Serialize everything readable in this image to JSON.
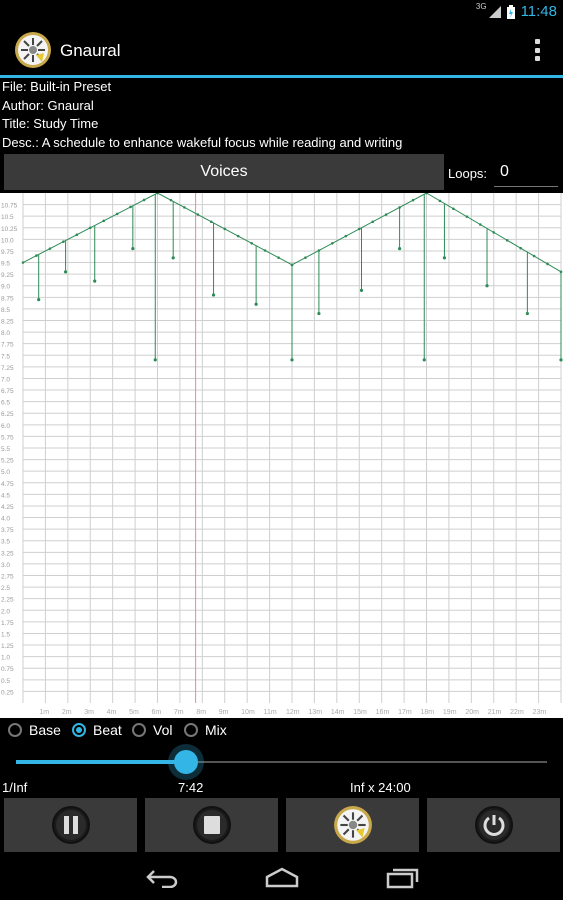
{
  "status": {
    "network": "3G",
    "time": "11:48"
  },
  "app": {
    "title": "Gnaural",
    "icon": "gnaural-logo-icon"
  },
  "info": {
    "file": "File: Built-in Preset",
    "author": "Author: Gnaural",
    "title": "Title: Study Time",
    "desc": "Desc.: A schedule to enhance wakeful focus while reading and writing"
  },
  "voices_label": "Voices",
  "loops": {
    "label": "Loops:",
    "value": "0"
  },
  "graph": {
    "y_labels": [
      "10.75",
      "10.5",
      "10.25",
      "10.0",
      "9.75",
      "9.5",
      "9.25",
      "9.0",
      "8.75",
      "8.5",
      "8.25",
      "8.0",
      "7.75",
      "7.5",
      "7.25",
      "7.0",
      "6.75",
      "6.5",
      "6.25",
      "6.0",
      "5.75",
      "5.5",
      "5.25",
      "5.0",
      "4.75",
      "4.5",
      "4.25",
      "4.0",
      "3.75",
      "3.5",
      "3.25",
      "3.0",
      "2.75",
      "2.5",
      "2.25",
      "2.0",
      "1.75",
      "1.5",
      "1.25",
      "1.0",
      "0.75",
      "0.5",
      "0.25"
    ],
    "x_labels": [
      "1m",
      "2m",
      "3m",
      "4m",
      "5m",
      "6m",
      "7m",
      "8m",
      "9m",
      "10m",
      "11m",
      "12m",
      "13m",
      "14m",
      "15m",
      "16m",
      "17m",
      "18m",
      "19m",
      "20m",
      "21m",
      "22m",
      "23m"
    ],
    "line_color": "#2e8b57",
    "cursor_color": "#ff8080",
    "cursor_minute": 7.7,
    "y_max": 11.0,
    "x_max": 24.0,
    "line_points": [
      [
        0,
        9.5
      ],
      [
        6,
        11.0
      ],
      [
        12,
        9.45
      ],
      [
        18,
        11.0
      ],
      [
        24,
        9.3
      ]
    ],
    "spikes": [
      [
        0.7,
        8.7
      ],
      [
        1.9,
        9.3
      ],
      [
        3.2,
        9.1
      ],
      [
        4.9,
        9.8
      ],
      [
        5.9,
        7.4
      ],
      [
        6.7,
        9.6
      ],
      [
        8.5,
        8.8
      ],
      [
        10.4,
        8.6
      ],
      [
        12.0,
        7.4
      ],
      [
        13.2,
        8.4
      ],
      [
        15.1,
        8.9
      ],
      [
        16.8,
        9.8
      ],
      [
        17.9,
        7.4
      ],
      [
        18.8,
        9.6
      ],
      [
        20.7,
        9.0
      ],
      [
        22.5,
        8.4
      ],
      [
        24.0,
        7.4
      ]
    ]
  },
  "modes": [
    {
      "label": "Base",
      "checked": false
    },
    {
      "label": "Beat",
      "checked": true
    },
    {
      "label": "Vol",
      "checked": false
    },
    {
      "label": "Mix",
      "checked": false
    }
  ],
  "progress": 0.32,
  "times": {
    "loop": "1/Inf",
    "elapsed": "7:42",
    "total": "Inf x 24:00"
  },
  "controls": [
    "pause-icon",
    "stop-icon",
    "gnaural-logo-icon",
    "power-icon"
  ],
  "nav": [
    "back-icon",
    "home-icon",
    "recent-apps-icon"
  ],
  "accent": "#33b5e5"
}
